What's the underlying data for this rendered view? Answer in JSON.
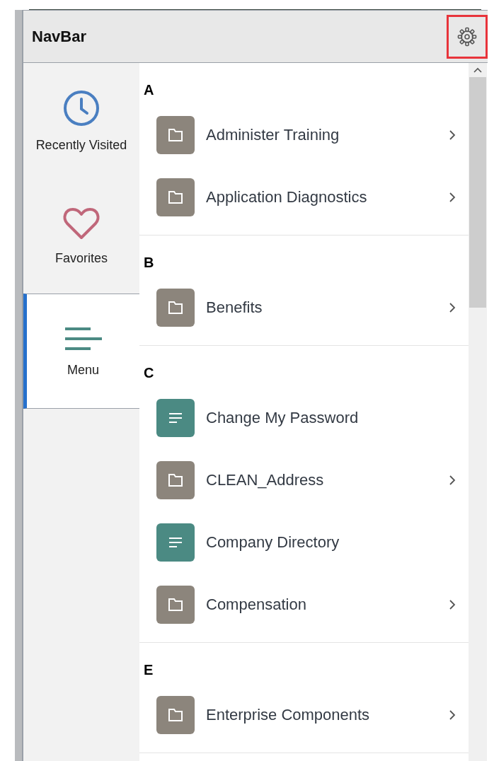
{
  "header": {
    "title": "NavBar",
    "settings_button": {
      "highlighted": true
    }
  },
  "sidebar": {
    "items": [
      {
        "label": "Recently Visited",
        "kind": "clock",
        "selected": false
      },
      {
        "label": "Favorites",
        "kind": "heart",
        "selected": false
      },
      {
        "label": "Menu",
        "kind": "menu",
        "selected": true
      }
    ]
  },
  "menu": {
    "sections": [
      {
        "letter": "A",
        "items": [
          {
            "label": "Administer Training",
            "kind": "folder"
          },
          {
            "label": "Application Diagnostics",
            "kind": "folder"
          }
        ]
      },
      {
        "letter": "B",
        "items": [
          {
            "label": "Benefits",
            "kind": "folder"
          }
        ]
      },
      {
        "letter": "C",
        "items": [
          {
            "label": "Change My Password",
            "kind": "page"
          },
          {
            "label": "CLEAN_Address",
            "kind": "folder"
          },
          {
            "label": "Company Directory",
            "kind": "page"
          },
          {
            "label": "Compensation",
            "kind": "folder"
          }
        ]
      },
      {
        "letter": "E",
        "items": [
          {
            "label": "Enterprise Components",
            "kind": "folder"
          }
        ]
      }
    ]
  }
}
